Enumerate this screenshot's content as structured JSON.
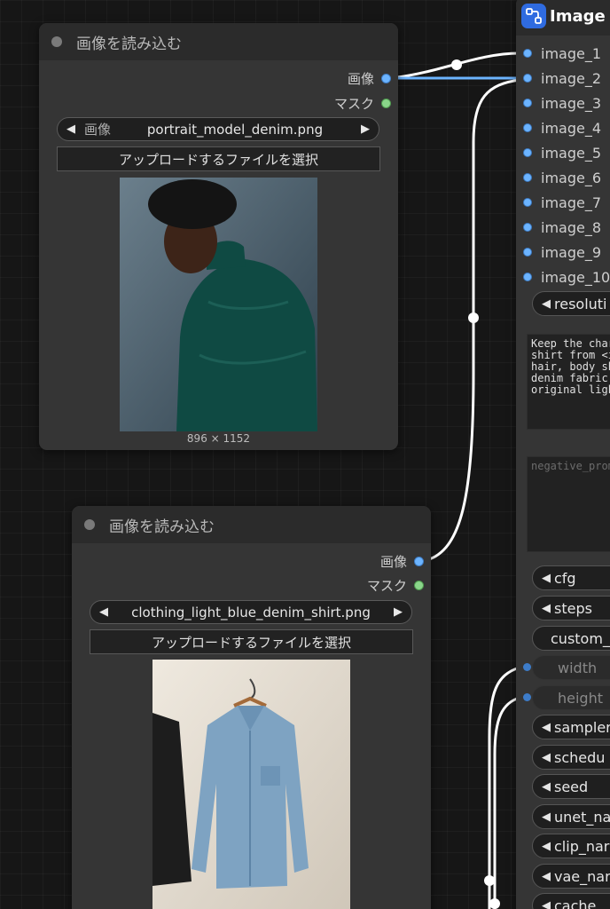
{
  "colors": {
    "canvas_bg": "#161616",
    "node_bg": "#353535",
    "node_header": "#2b2b2b",
    "image_slot": "#6cb4ff",
    "mask_slot": "#8ad68a",
    "link_image": "#6cb4ff",
    "link_default": "#ffffff",
    "badge": "#2f6be0"
  },
  "load_node_1": {
    "title": "画像を読み込む",
    "outputs": {
      "image": "画像",
      "mask": "マスク"
    },
    "combo": {
      "label": "画像",
      "value": "portrait_model_denim.png"
    },
    "upload_label": "アップロードするファイルを選択",
    "dimensions": "896 × 1152"
  },
  "load_node_2": {
    "title": "画像を読み込む",
    "outputs": {
      "image": "画像",
      "mask": "マスク"
    },
    "combo": {
      "value": "clothing_light_blue_denim_shirt.png"
    },
    "upload_label": "アップロードするファイルを選択"
  },
  "right_node": {
    "title": "Image E",
    "icon": "node-flow-icon",
    "inputs": [
      "image_1",
      "image_2",
      "image_3",
      "image_4",
      "image_5",
      "image_6",
      "image_7",
      "image_8",
      "image_9",
      "image_10"
    ],
    "resolution_label": "resoluti",
    "prompt_text": "Keep the char\nshirt from <i\nhair, body sh\ndenim fabric \noriginal ligh",
    "negative_placeholder": "negative_prom",
    "widgets": {
      "cfg": "cfg",
      "steps": "steps",
      "custom": "custom_",
      "width": "width",
      "height": "height",
      "sampler": "sampler",
      "scheduler": "schedu",
      "seed": "seed",
      "unet": "unet_na",
      "clip": "clip_nar",
      "vae": "vae_nar",
      "cache": "cache"
    }
  }
}
